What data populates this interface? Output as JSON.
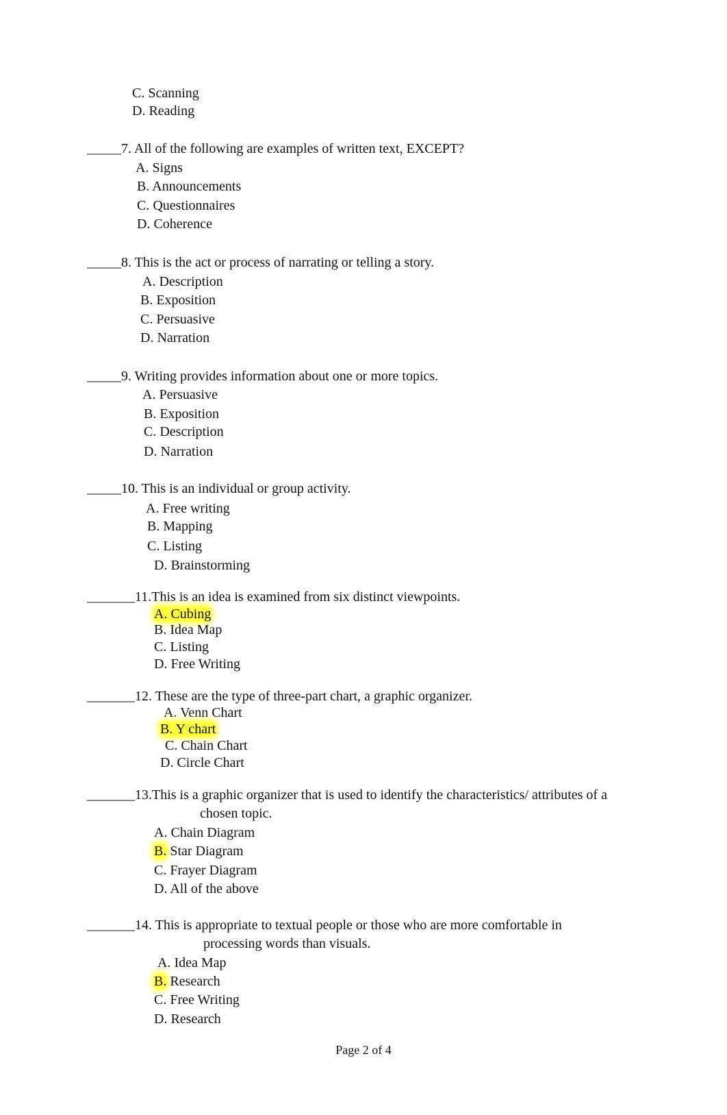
{
  "continued_options": [
    {
      "label": "C.",
      "text": "Scanning"
    },
    {
      "label": "D.",
      "text": "Reading"
    }
  ],
  "questions": [
    {
      "blank": "_____",
      "number": "7.",
      "text": "All of the following are examples of written text, EXCEPT?",
      "text_cont": "",
      "options": [
        {
          "label": "A.",
          "text": "Signs",
          "highlight": "none"
        },
        {
          "label": "B.",
          "text": "Announcements",
          "highlight": "none"
        },
        {
          "label": "C.",
          "text": "Questionnaires",
          "highlight": "none"
        },
        {
          "label": "D.",
          "text": "Coherence",
          "highlight": "none"
        }
      ]
    },
    {
      "blank": "_____",
      "number": "8.",
      "text": "This is the act or process of narrating or telling a story.",
      "text_cont": "",
      "options": [
        {
          "label": "A.",
          "text": "Description",
          "highlight": "none"
        },
        {
          "label": "B.",
          "text": "Exposition",
          "highlight": "none"
        },
        {
          "label": "C.",
          "text": "Persuasive",
          "highlight": "none"
        },
        {
          "label": "D.",
          "text": "Narration",
          "highlight": "none"
        }
      ]
    },
    {
      "blank": "_____",
      "number": "9.",
      "text": "Writing provides information about one or more topics.",
      "text_cont": "",
      "options": [
        {
          "label": "A.",
          "text": "Persuasive",
          "highlight": "none"
        },
        {
          "label": "B.",
          "text": "Exposition",
          "highlight": "none"
        },
        {
          "label": "C.",
          "text": "Description",
          "highlight": "none"
        },
        {
          "label": "D.",
          "text": "Narration",
          "highlight": "none"
        }
      ]
    },
    {
      "blank": "_____",
      "number": "10.",
      "text": "This is an individual or group activity.",
      "text_cont": "",
      "options": [
        {
          "label": "A.",
          "text": "Free writing",
          "highlight": "none"
        },
        {
          "label": "B.",
          "text": "Mapping",
          "highlight": "none"
        },
        {
          "label": "C.",
          "text": "Listing",
          "highlight": "none"
        },
        {
          "label": "D.",
          "text": "Brainstorming",
          "highlight": "none"
        }
      ]
    },
    {
      "blank": "_______",
      "number": "11.",
      "text": "This is an idea is examined from six distinct viewpoints.",
      "text_cont": "",
      "options": [
        {
          "label": "A.",
          "text": "Cubing",
          "highlight": "full"
        },
        {
          "label": "B.",
          "text": "Idea Map",
          "highlight": "none"
        },
        {
          "label": "C.",
          "text": "Listing",
          "highlight": "none"
        },
        {
          "label": "D.",
          "text": "Free Writing",
          "highlight": "none"
        }
      ]
    },
    {
      "blank": "_______",
      "number": "12.",
      "text": "These are the type of three-part chart, a graphic organizer.",
      "text_cont": "",
      "options": [
        {
          "label": "A.",
          "text": "Venn Chart",
          "highlight": "none"
        },
        {
          "label": "B.",
          "text": "Y chart",
          "highlight": "full"
        },
        {
          "label": "C.",
          "text": "Chain Chart",
          "highlight": "none"
        },
        {
          "label": "D.",
          "text": "Circle Chart",
          "highlight": "none"
        }
      ]
    },
    {
      "blank": "_______",
      "number": "13.",
      "text": "This is a graphic organizer that is used to identify the characteristics/ attributes of a",
      "text_cont": "chosen topic.",
      "options": [
        {
          "label": "A.",
          "text": "Chain Diagram",
          "highlight": "none"
        },
        {
          "label": "B.",
          "text": "Star Diagram",
          "highlight": "label"
        },
        {
          "label": "C.",
          "text": "Frayer Diagram",
          "highlight": "none"
        },
        {
          "label": "D.",
          "text": "All of the above",
          "highlight": "none"
        }
      ]
    },
    {
      "blank": "_______",
      "number": "14.",
      "text": "This is appropriate to textual people or those who are more comfortable in",
      "text_cont": "processing words than visuals.",
      "options": [
        {
          "label": "A.",
          "text": "Idea Map",
          "highlight": "none"
        },
        {
          "label": "B.",
          "text": "Research",
          "highlight": "label"
        },
        {
          "label": "C.",
          "text": "Free Writing",
          "highlight": "none"
        },
        {
          "label": "D.",
          "text": "Research",
          "highlight": "none"
        }
      ]
    }
  ],
  "footer": {
    "page_label": "Page 2 of 4"
  },
  "colors": {
    "highlight": "#ffff40",
    "text": "#111111"
  }
}
